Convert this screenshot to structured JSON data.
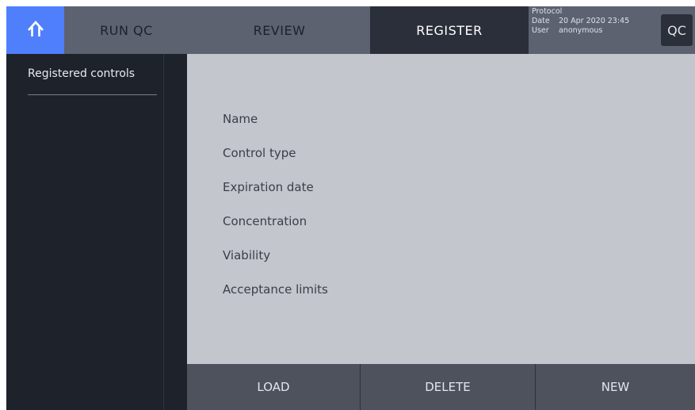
{
  "topbar": {
    "home_icon": "home-icon",
    "tabs": [
      {
        "label": "RUN QC",
        "active": false
      },
      {
        "label": "REVIEW",
        "active": false
      },
      {
        "label": "REGISTER",
        "active": true
      }
    ],
    "info": {
      "protocol_label": "Protocol",
      "protocol_value": "",
      "date_label": "Date",
      "date_value": "20 Apr 2020 23:45",
      "user_label": "User",
      "user_value": "anonymous"
    },
    "qc_label": "QC"
  },
  "sidebar": {
    "title": "Registered controls"
  },
  "form": {
    "fields": [
      {
        "label": "Name"
      },
      {
        "label": "Control type"
      },
      {
        "label": "Expiration date"
      },
      {
        "label": "Concentration"
      },
      {
        "label": "Viability"
      },
      {
        "label": "Acceptance limits"
      }
    ]
  },
  "actions": {
    "load": "LOAD",
    "delete": "DELETE",
    "new": "NEW"
  },
  "colors": {
    "accent": "#4f7ffb",
    "topbar": "#5d6271",
    "active_tab": "#2b2f3a",
    "background": "#1e222b",
    "panel": "#c3c6cd",
    "bottombar": "#4d525d"
  }
}
